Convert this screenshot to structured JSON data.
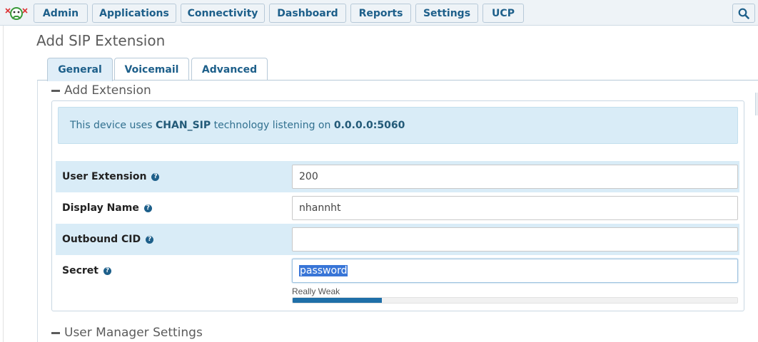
{
  "nav": {
    "items": [
      "Admin",
      "Applications",
      "Connectivity",
      "Dashboard",
      "Reports",
      "Settings",
      "UCP"
    ],
    "search_icon": "search-icon"
  },
  "page": {
    "title": "Add SIP Extension"
  },
  "tabs": [
    "General",
    "Voicemail",
    "Advanced"
  ],
  "active_tab": "General",
  "sections": {
    "add_extension": "Add Extension",
    "user_manager": "User Manager Settings"
  },
  "alert": {
    "prefix": "This device uses ",
    "tech": "CHAN_SIP",
    "middle": " technology listening on ",
    "address": "0.0.0.0:5060"
  },
  "fields": [
    {
      "label": "User Extension",
      "value": "200"
    },
    {
      "label": "Display Name",
      "value": "nhannht"
    },
    {
      "label": "Outbound CID",
      "value": ""
    },
    {
      "label": "Secret",
      "value": "password"
    }
  ],
  "password_strength": {
    "label": "Really Weak",
    "level_fraction": 0.2
  },
  "colors": {
    "accent": "#1d5f8a",
    "row_shade": "#d9ecf7",
    "strength_bar": "#1f6fa8"
  }
}
